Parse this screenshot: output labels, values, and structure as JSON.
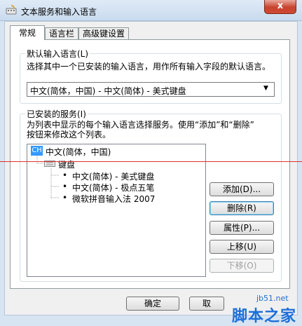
{
  "window": {
    "title": "文本服务和输入语言",
    "close_label": "x"
  },
  "tabs": [
    {
      "label": "常规",
      "active": true
    },
    {
      "label": "语言栏",
      "active": false
    },
    {
      "label": "高级键设置",
      "active": false
    }
  ],
  "default_lang": {
    "group_title": "默认输入语言(L)",
    "description": "选择其中一个已安装的输入语言，用作所有输入字段的默认语言。",
    "selected": "中文(简体，中国) - 中文(简体) - 美式键盘"
  },
  "installed": {
    "group_title": "已安装的服务(I)",
    "description_line1": "为列表中显示的每个输入语言选择服务。使用“添加”和“删除”",
    "description_line2": "按钮来修改这个列表。",
    "lang_badge": "CH",
    "lang_name": "中文(简体，中国)",
    "category": "键盘",
    "services": [
      "中文(简体) - 美式键盘",
      "中文(简体) - 极点五笔",
      "微软拼音输入法 2007"
    ]
  },
  "buttons": {
    "add": "添加(D)...",
    "remove": "删除(R)",
    "properties": "属性(P)...",
    "move_up": "上移(U)",
    "move_down": "下移(O)"
  },
  "footer": {
    "ok": "确定",
    "cancel": "取"
  },
  "watermark": {
    "url": "jb51.net",
    "text": "脚本之家"
  },
  "colors": {
    "accent": "#3399ff",
    "annotation_line": "#e03030"
  }
}
